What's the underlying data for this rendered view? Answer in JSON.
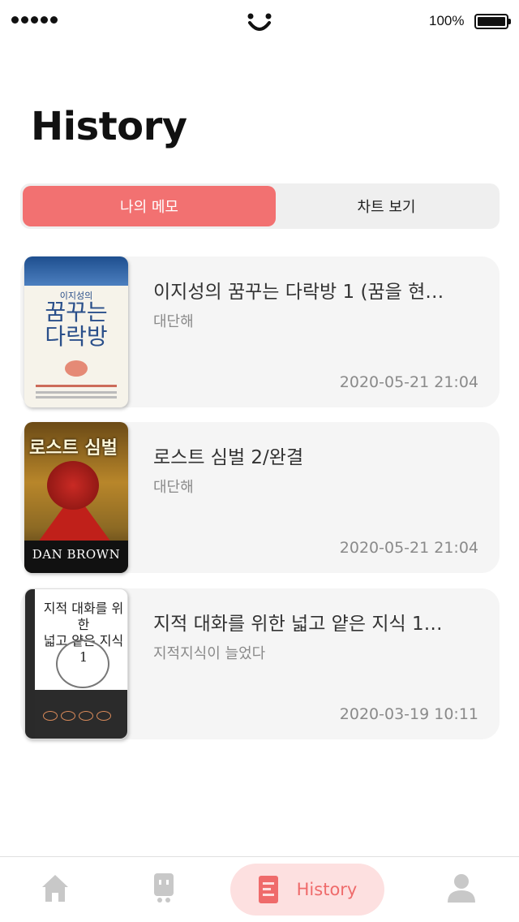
{
  "status_bar": {
    "battery_percent": "100%",
    "signal_icon": "signal-dots-icon",
    "center_icon": "smiley-icon"
  },
  "page": {
    "title": "History"
  },
  "tabs": {
    "active_label": "나의 메모",
    "inactive_label": "차트 보기",
    "active_color": "#f27171"
  },
  "cards": [
    {
      "title": "이지성의 꿈꾸는 다락방 1 (꿈을 현…",
      "memo": "대단해",
      "date": "2020-05-21 21:04",
      "cover": {
        "small_title": "이지성의",
        "main_title": "꿈꾸는\n다락방"
      }
    },
    {
      "title": "로스트 심벌 2/완결",
      "memo": "대단해",
      "date": "2020-05-21 21:04",
      "cover": {
        "main_title": "로스트 심벌",
        "author": "DAN BROWN"
      }
    },
    {
      "title": "지적 대화를 위한 넓고 얕은 지식 1…",
      "memo": "지적지식이 늘었다",
      "date": "2020-03-19 10:11",
      "cover": {
        "main_title": "지적 대화를 위한\n넓고 얕은 지식 1"
      }
    }
  ],
  "tab_bar": {
    "items": [
      {
        "icon": "home-icon"
      },
      {
        "icon": "robot-icon"
      },
      {
        "icon": "document-icon",
        "label": "History",
        "active": true
      },
      {
        "icon": "profile-icon"
      }
    ],
    "active_color": "#ef6b6b",
    "inactive_color": "#c8c8c8"
  }
}
